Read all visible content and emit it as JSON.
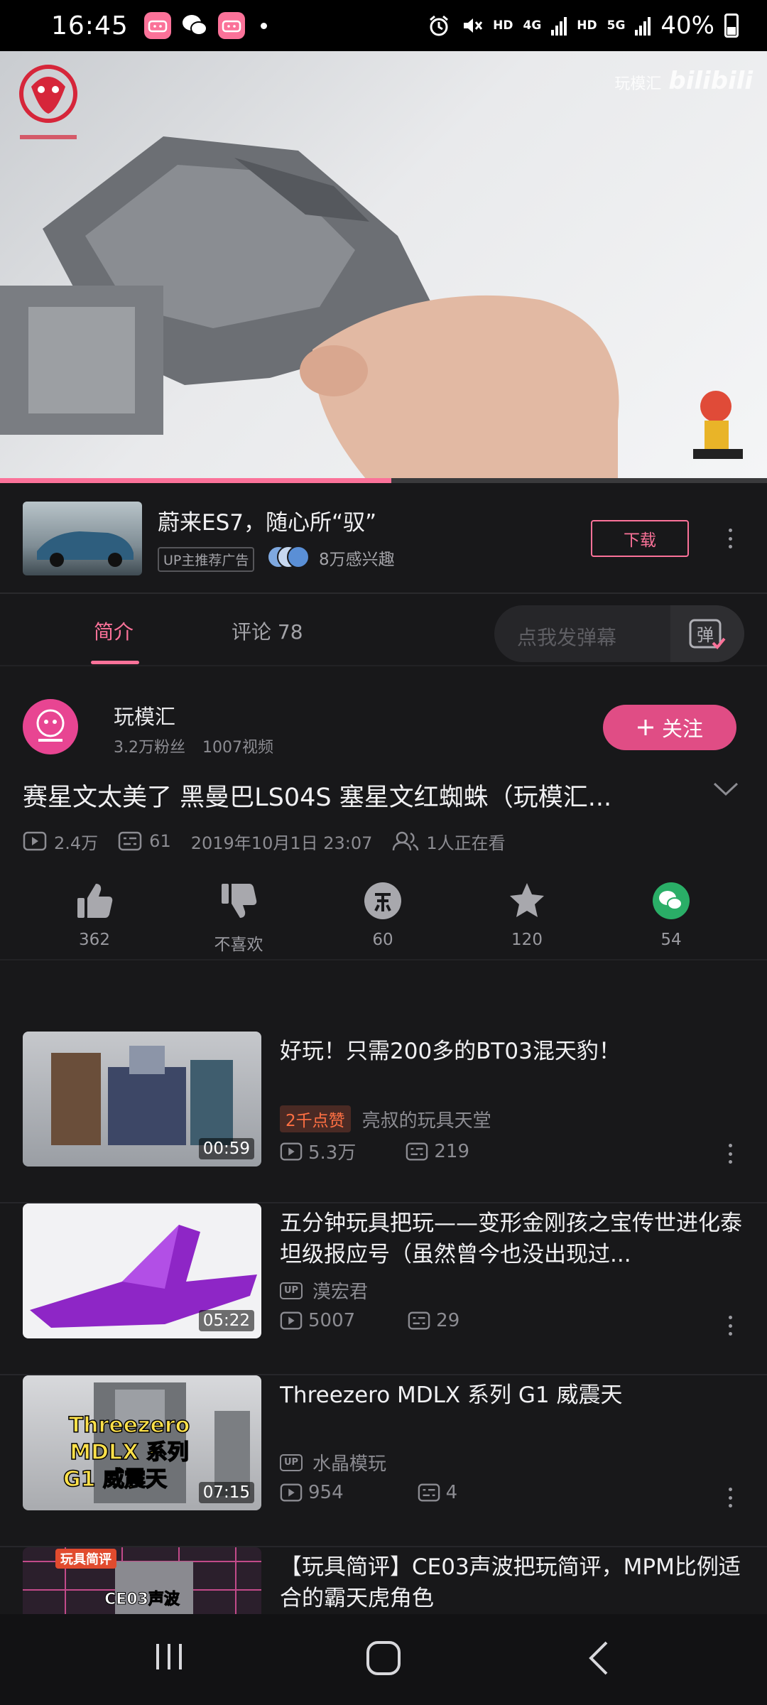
{
  "status_bar": {
    "time": "16:45",
    "net_1": "HD",
    "net_gen_1": "4G",
    "net_2": "HD",
    "net_gen_2": "5G",
    "battery": "40%"
  },
  "video": {
    "watermark_prefix": "玩模汇",
    "watermark_brand": "bilibili",
    "progress_fraction": 0.51
  },
  "ad": {
    "title": "蔚来ES7，随心所“驭”",
    "tag": "UP主推荐广告",
    "interest": "8万感兴趣",
    "download_label": "下载"
  },
  "tabs": {
    "intro": "简介",
    "comments": "评论",
    "comments_count": "78",
    "danmaku_placeholder": "点我发弹幕",
    "danmaku_icon_char": "弹"
  },
  "uploader": {
    "name": "玩模汇",
    "fans": "3.2万粉丝",
    "videos": "1007视频",
    "follow_label": "关注"
  },
  "video_info": {
    "title": "赛星文太美了 黑曼巴LS04S 塞星文红蜘蛛（玩模汇...",
    "views": "2.4万",
    "danmaku": "61",
    "date": "2019年10月1日 23:07",
    "watching": "1人正在看"
  },
  "actions": {
    "like": "362",
    "dislike": "不喜欢",
    "coin": "60",
    "favorite": "120",
    "share": "54"
  },
  "related": [
    {
      "title": "好玩！只需200多的BT03混天豹！",
      "duration": "00:59",
      "badge": "2千点赞",
      "author": "亮叔的玩具天堂",
      "views": "5.3万",
      "danmaku": "219"
    },
    {
      "title": "五分钟玩具把玩——变形金刚孩之宝传世进化泰坦级报应号（虽然曾今也没出现过...",
      "duration": "05:22",
      "author": "漠宏君",
      "views": "5007",
      "danmaku": "29"
    },
    {
      "title": "Threezero MDLX 系列 G1 威震天",
      "duration": "07:15",
      "author": "水晶模玩",
      "views": "954",
      "danmaku": "4",
      "thumb_text": [
        "Threezero",
        "MDLX 系列",
        "G1 威震天"
      ]
    },
    {
      "title": "【玩具简评】CE03声波把玩简评，MPM比例适合的霸天虎角色",
      "thumb_tag": "玩具简评",
      "thumb_text": "CE03声波"
    }
  ],
  "colors": {
    "accent": "#fb7299",
    "follow": "#e04d85",
    "background": "#18181a",
    "hot": "#ff7043",
    "wechat": "#2aae67"
  }
}
